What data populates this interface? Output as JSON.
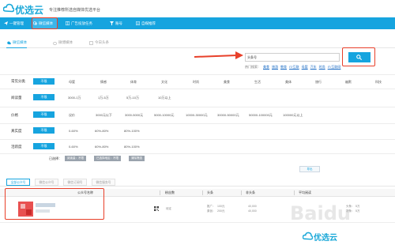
{
  "brand": {
    "name": "优选云",
    "slogan": "专注推荐所选自媒体优选平台"
  },
  "nav": {
    "items": [
      {
        "label": "一键管理"
      },
      {
        "label": "微信媒体"
      },
      {
        "label": "广告投放任务"
      },
      {
        "label": "账号"
      },
      {
        "label": "自媒推荐"
      }
    ],
    "active_index": 1
  },
  "tabs": {
    "items": [
      {
        "label": "微信媒体"
      },
      {
        "label": "微博媒体"
      },
      {
        "label": "今日头条"
      }
    ]
  },
  "search": {
    "value": "头条号",
    "hot_label": "热门搜索：",
    "hot_links": [
      "美食",
      "旅游",
      "教育",
      "IT/互联",
      "母婴",
      "汽车",
      "时尚",
      "IT/互联网"
    ]
  },
  "filters": {
    "category": {
      "label": "常见分类",
      "active": "不限",
      "options": [
        "母婴",
        "情感",
        "体育",
        "文化",
        "时尚",
        "美食",
        "生活",
        "美体",
        "旅行",
        "幽默",
        "科技"
      ]
    },
    "fans": {
      "label": "阅读量",
      "active": "不限",
      "options": [
        "3000-1万",
        "1万-5万",
        "5万-10万",
        "10万以上"
      ]
    },
    "price": {
      "label": "价格",
      "active": "不限",
      "options": [
        "议价",
        "3000元以下",
        "3000-5000元",
        "5000-10000元",
        "10000-30000元",
        "30000-50000元",
        "50000-100000元",
        "100000元以上"
      ]
    },
    "real": {
      "label": "真实度",
      "active": "不限",
      "options": [
        "0-60%",
        "60%-80%",
        "80%-100%"
      ]
    },
    "active_rate": {
      "label": "活跃度",
      "active": "不限",
      "options": [
        "0-60%",
        "60%-80%",
        "80%-100%"
      ]
    }
  },
  "selected": {
    "label": "已选择：",
    "chips": [
      "阅读量：不限",
      "已选择地区：不限",
      "清除筛选"
    ]
  },
  "export_label": "导出",
  "results": {
    "tabs": [
      "全部公众号",
      "微信公众号",
      "微信订阅号",
      "微信服务号"
    ],
    "columns": [
      "公众号名称",
      "粉丝数",
      "头条",
      "非头条",
      "平均阅读"
    ],
    "rows": [
      {
        "fans": "待定",
        "head_label1": "推广：",
        "head_val1": "100元",
        "head_label2": "原创：",
        "head_val2": "200元",
        "nonhead_val1": "40,000",
        "nonhead_val2": "40,000",
        "avg_label1": "头条：",
        "avg_val1": "5万",
        "avg_label2": "次条：",
        "avg_val2": "5万"
      }
    ]
  },
  "watermark": "Baidu"
}
